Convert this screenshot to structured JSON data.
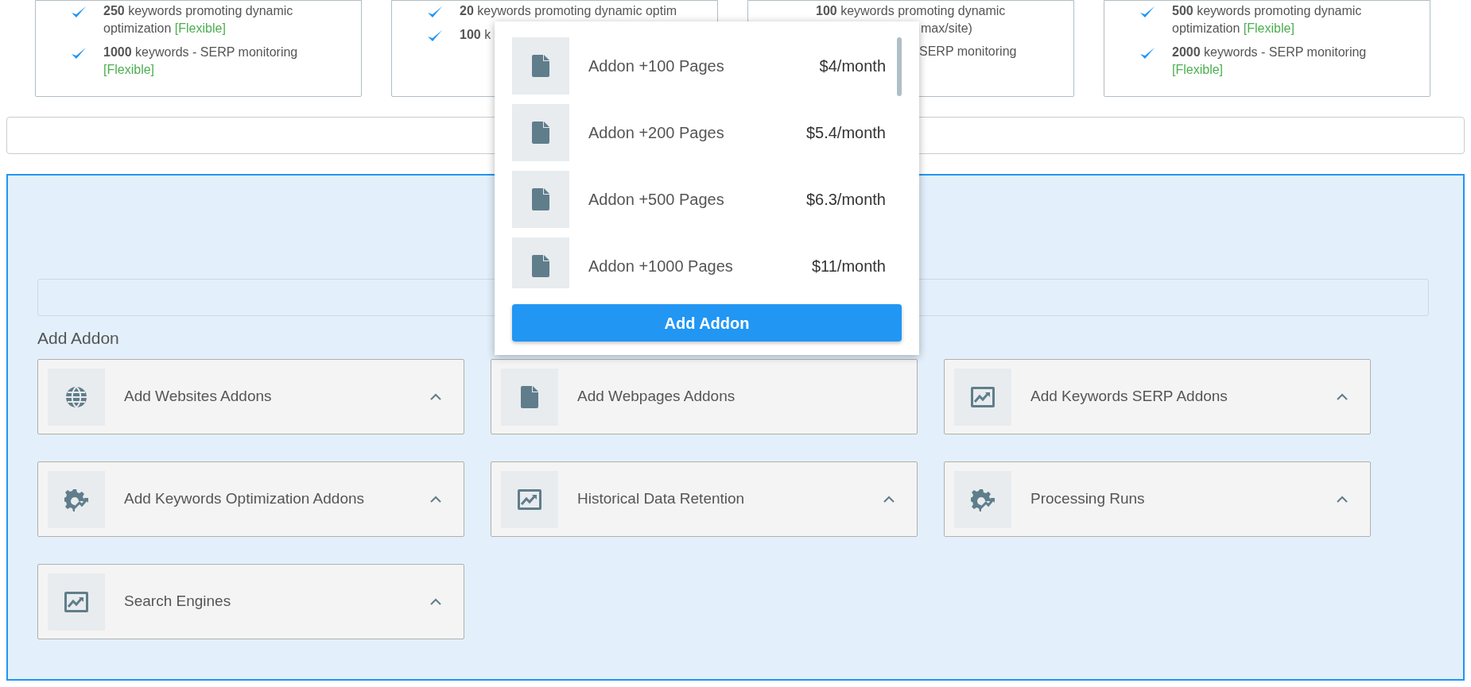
{
  "plans": [
    {
      "kind": "list",
      "features": [
        {
          "text": "**250** keywords promoting dynamic optimization",
          "tag": "[Flexible]"
        },
        {
          "text": "**1000** keywords - SERP monitoring",
          "tag": "[Flexible]"
        }
      ]
    },
    {
      "kind": "list",
      "features": [
        {
          "text": "**20** keywords promoting dynamic optim"
        },
        {
          "text": "**100** k"
        }
      ]
    },
    {
      "kind": "fragments",
      "lines": [
        "**100** keywords promoting dynamic",
        "max/site)",
        "SERP monitoring"
      ]
    },
    {
      "kind": "list",
      "features": [
        {
          "text": "**500** keywords promoting dynamic optimization",
          "tag": "[Flexible]"
        },
        {
          "text": "**2000** keywords - SERP monitoring",
          "tag": "[Flexible]"
        }
      ]
    }
  ],
  "addon_section": {
    "heading": "Add Addon",
    "cards": [
      {
        "kind": "site",
        "label": "Add Websites Addons",
        "expanded": false
      },
      {
        "kind": "page",
        "label": "Add Webpages Addons",
        "expanded": true
      },
      {
        "kind": "chart",
        "label": "Add Keywords SERP Addons",
        "expanded": false
      },
      {
        "kind": "tool",
        "label": "Add Keywords Optimization Addons",
        "expanded": false
      },
      {
        "kind": "chart",
        "label": "Historical Data Retention",
        "expanded": false
      },
      {
        "kind": "tool",
        "label": "Processing Runs",
        "expanded": false
      },
      {
        "kind": "chart",
        "label": "Search Engines",
        "expanded": false
      }
    ]
  },
  "dropdown": {
    "options": [
      {
        "label": "Addon +100 Pages",
        "price": "$4/month"
      },
      {
        "label": "Addon +200 Pages",
        "price": "$5.4/month"
      },
      {
        "label": "Addon +500 Pages",
        "price": "$6.3/month"
      },
      {
        "label": "Addon +1000 Pages",
        "price": "$11/month"
      }
    ],
    "button": "Add Addon"
  }
}
